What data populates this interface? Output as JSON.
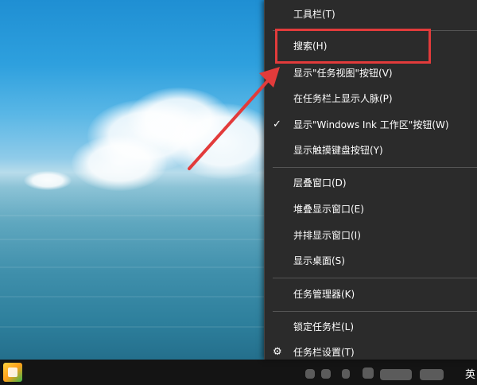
{
  "menu": {
    "items": [
      {
        "label": "工具栏(T)"
      },
      {
        "label": "搜索(H)"
      },
      {
        "label": "显示\"任务视图\"按钮(V)"
      },
      {
        "label": "在任务栏上显示人脉(P)"
      },
      {
        "label": "显示\"Windows Ink 工作区\"按钮(W)",
        "checked": true
      },
      {
        "label": "显示触摸键盘按钮(Y)"
      },
      {
        "label": "层叠窗口(D)"
      },
      {
        "label": "堆叠显示窗口(E)"
      },
      {
        "label": "并排显示窗口(I)"
      },
      {
        "label": "显示桌面(S)"
      },
      {
        "label": "任务管理器(K)"
      },
      {
        "label": "锁定任务栏(L)"
      },
      {
        "label": "任务栏设置(T)"
      }
    ]
  },
  "taskbar": {
    "tray_text": "英"
  },
  "icons": {
    "check": "check-icon",
    "gear": "gear-icon",
    "app": "app-icon"
  },
  "colors": {
    "menu_bg": "#2b2b2b",
    "highlight": "#e23b3b",
    "taskbar_bg": "#141414"
  }
}
